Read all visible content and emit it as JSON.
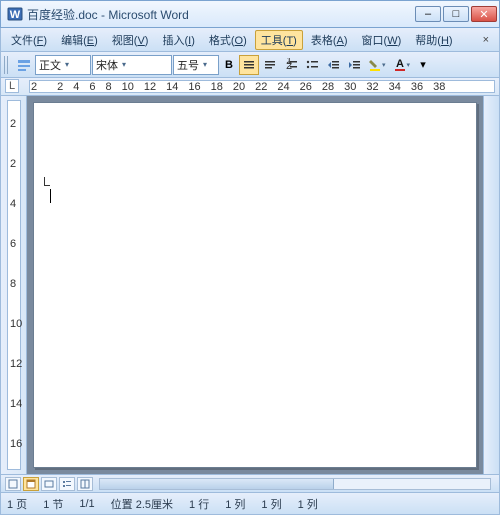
{
  "title": "百度经验.doc - Microsoft Word",
  "window": {
    "min": "–",
    "max": "□",
    "close": "✕"
  },
  "menu": {
    "file": {
      "label": "文件",
      "key": "F"
    },
    "edit": {
      "label": "编辑",
      "key": "E"
    },
    "view": {
      "label": "视图",
      "key": "V"
    },
    "insert": {
      "label": "插入",
      "key": "I"
    },
    "format": {
      "label": "格式",
      "key": "O"
    },
    "tools": {
      "label": "工具",
      "key": "T"
    },
    "table": {
      "label": "表格",
      "key": "A"
    },
    "window": {
      "label": "窗口",
      "key": "W"
    },
    "help": {
      "label": "帮助",
      "key": "H"
    },
    "close_x": "×"
  },
  "toolbar": {
    "style": "正文",
    "font": "宋体",
    "size": "五号",
    "bold": "B",
    "cornerL": "L"
  },
  "ruler": {
    "h": [
      "2",
      "",
      "2",
      "4",
      "6",
      "8",
      "10",
      "12",
      "14",
      "16",
      "18",
      "20",
      "22",
      "24",
      "26",
      "28",
      "30",
      "32",
      "34",
      "36",
      "38"
    ],
    "v": [
      "",
      "2",
      "",
      "2",
      "",
      "4",
      "",
      "6",
      "",
      "8",
      "",
      "10",
      "",
      "12",
      "",
      "14",
      "",
      "16"
    ]
  },
  "status": {
    "page": "1 页",
    "sec": "1 节",
    "pages": "1/1",
    "pos": "位置 2.5厘米",
    "line": "1 行",
    "col1": "1 列",
    "col2": "1 列",
    "col3": "1 列"
  }
}
